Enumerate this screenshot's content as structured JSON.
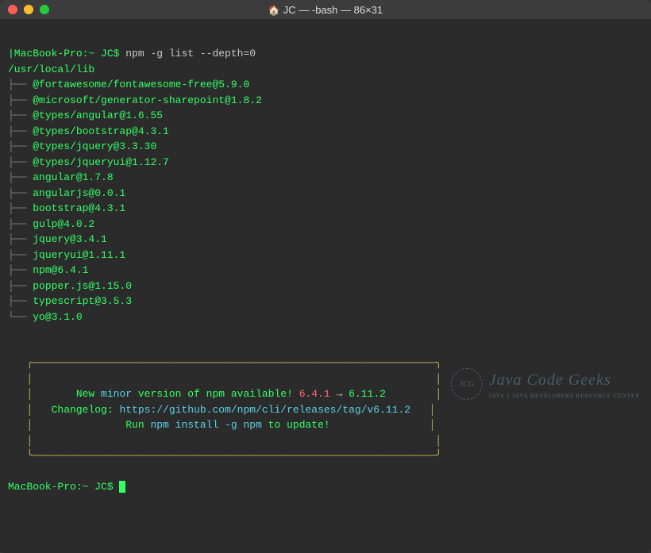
{
  "window": {
    "title": "JC — -bash — 86×31"
  },
  "prompt1": {
    "prefix": "|MacBook-Pro:~ JC$ ",
    "command": "npm -g list --depth=0"
  },
  "root_path": "/usr/local/lib",
  "packages": [
    "@fortawesome/fontawesome-free@5.9.0",
    "@microsoft/generator-sharepoint@1.8.2",
    "@types/angular@1.6.55",
    "@types/bootstrap@4.3.1",
    "@types/jquery@3.3.30",
    "@types/jqueryui@1.12.7",
    "angular@1.7.8",
    "angularjs@0.0.1",
    "bootstrap@4.3.1",
    "gulp@4.0.2",
    "jquery@3.4.1",
    "jqueryui@1.11.1",
    "npm@6.4.1",
    "popper.js@1.15.0",
    "typescript@3.5.3",
    "yo@3.1.0"
  ],
  "tree": {
    "mid": "├── ",
    "last": "└── "
  },
  "notice": {
    "line1_a": "New ",
    "line1_b": "minor",
    "line1_c": " version of npm available! ",
    "line1_d": "6.4.1",
    "line1_e": " → ",
    "line1_f": "6.11.2",
    "line2_a": "Changelog: ",
    "line2_b": "https://github.com/npm/cli/releases/tag/v6.11.2",
    "line3_a": "Run ",
    "line3_b": "npm install -g npm",
    "line3_c": " to update!"
  },
  "prompt2": {
    "prefix": "MacBook-Pro:~ JC$ "
  },
  "watermark": {
    "logo_text": "JCG",
    "main": "Java Code Geeks",
    "sub": "JAVA 2 JAVA DEVELOPERS RESOURCE CENTER"
  }
}
